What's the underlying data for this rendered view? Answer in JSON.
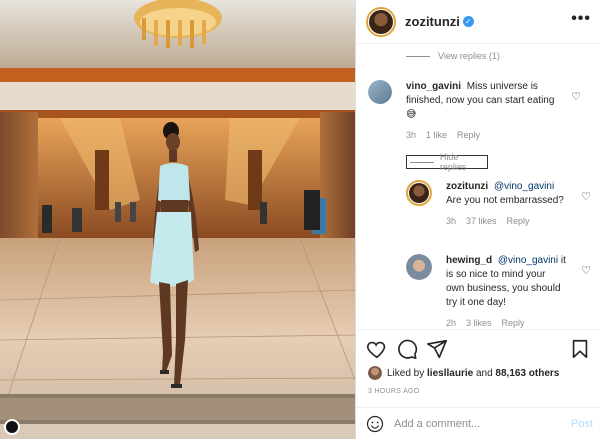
{
  "post": {
    "username": "zozitunzi",
    "verified_glyph": "✓",
    "more_icon": "more-options-icon"
  },
  "comments": {
    "view_replies": "View replies (1)",
    "hide_replies": "Hide replies",
    "items": [
      {
        "username": "vino_gavini",
        "text": "Miss universe is finished, now you can start eating",
        "emoji": "😅",
        "time": "3h",
        "likes": "1 like",
        "reply": "Reply"
      }
    ],
    "replies": [
      {
        "username": "zozitunzi",
        "mention": "@vino_gavini",
        "text": "Are you not embarrassed?",
        "time": "3h",
        "likes": "37 likes",
        "reply": "Reply"
      },
      {
        "username": "hewing_d",
        "mention": "@vino_gavini",
        "text": "it is so nice to mind your own business, you should try it one day!",
        "time": "2h",
        "likes": "3 likes",
        "reply": "Reply"
      }
    ]
  },
  "likes": {
    "prefix": "Liked by",
    "user": "liesllaurie",
    "conj": "and",
    "others": "88,163 others"
  },
  "posted_ago": "3 HOURS AGO",
  "add_comment": {
    "placeholder": "Add a comment...",
    "post_label": "Post"
  },
  "colors": {
    "accent": "#3897f0",
    "story_ring": "#e2a43c",
    "post_disabled": "#b2dffc"
  }
}
